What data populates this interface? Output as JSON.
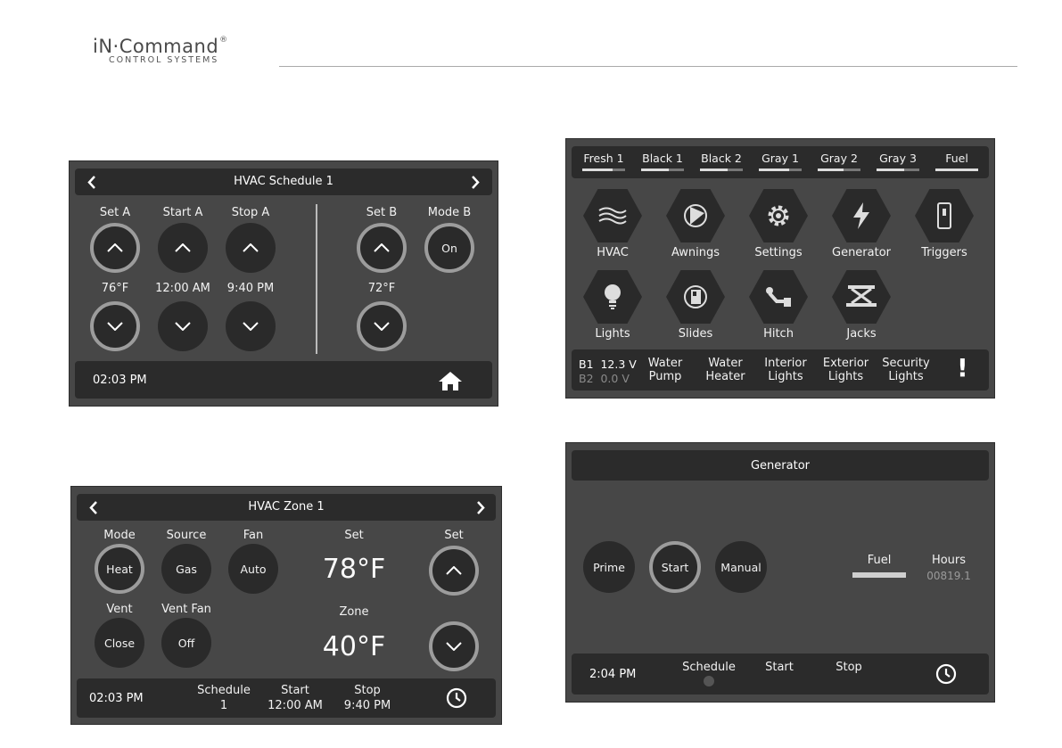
{
  "logo": {
    "brand": "iN·Command",
    "reg": "®",
    "sub": "CONTROL SYSTEMS"
  },
  "schedule": {
    "title": "HVAC Schedule 1",
    "set_a": "Set A",
    "start_a": "Start A",
    "stop_a": "Stop A",
    "set_b": "Set B",
    "mode_b": "Mode B",
    "mode_b_value": "On",
    "set_a_value": "76°F",
    "start_a_value": "12:00 AM",
    "stop_a_value": "9:40 PM",
    "set_b_value": "72°F",
    "time": "02:03 PM"
  },
  "zone": {
    "title": "HVAC Zone 1",
    "mode_label": "Mode",
    "mode_value": "Heat",
    "source_label": "Source",
    "source_value": "Gas",
    "fan_label": "Fan",
    "fan_value": "Auto",
    "set_label": "Set",
    "set_value": "78°F",
    "set_right_label": "Set",
    "vent_label": "Vent",
    "vent_value": "Close",
    "ventfan_label": "Vent Fan",
    "ventfan_value": "Off",
    "zone_label": "Zone",
    "zone_value": "40°F",
    "time": "02:03 PM",
    "schedule_label": "Schedule",
    "schedule_value": "1",
    "start_label": "Start",
    "start_value": "12:00 AM",
    "stop_label": "Stop",
    "stop_value": "9:40 PM"
  },
  "home": {
    "tanks": [
      {
        "name": "Fresh 1",
        "level": 0.7
      },
      {
        "name": "Black 1",
        "level": 0.65
      },
      {
        "name": "Black 2",
        "level": 0.65
      },
      {
        "name": "Gray 1",
        "level": 0.7
      },
      {
        "name": "Gray 2",
        "level": 0.6
      },
      {
        "name": "Gray 3",
        "level": 0.65
      },
      {
        "name": "Fuel",
        "level": 1.0
      }
    ],
    "icons": [
      {
        "label": "HVAC",
        "icon": "hvac-icon"
      },
      {
        "label": "Awnings",
        "icon": "awning-icon"
      },
      {
        "label": "Settings",
        "icon": "gear-icon"
      },
      {
        "label": "Generator",
        "icon": "lightning-icon"
      },
      {
        "label": "Triggers",
        "icon": "switch-icon"
      },
      {
        "label": "Lights",
        "icon": "bulb-icon"
      },
      {
        "label": "Slides",
        "icon": "slide-icon"
      },
      {
        "label": "Hitch",
        "icon": "hitch-icon"
      },
      {
        "label": "Jacks",
        "icon": "jack-icon"
      }
    ],
    "b1": "B1",
    "b1_value": "12.3 V",
    "b2": "B2",
    "b2_value": "0.0 V",
    "quick": [
      {
        "l1": "Water",
        "l2": "Pump"
      },
      {
        "l1": "Water",
        "l2": "Heater"
      },
      {
        "l1": "Interior",
        "l2": "Lights"
      },
      {
        "l1": "Exterior",
        "l2": "Lights"
      },
      {
        "l1": "Security",
        "l2": "Lights"
      }
    ],
    "alert": "!"
  },
  "generator": {
    "title": "Generator",
    "prime": "Prime",
    "start": "Start",
    "manual": "Manual",
    "fuel_label": "Fuel",
    "hours_label": "Hours",
    "hours_value": "00819.1",
    "time": "2:04 PM",
    "schedule_label": "Schedule",
    "start_label": "Start",
    "stop_label": "Stop"
  }
}
